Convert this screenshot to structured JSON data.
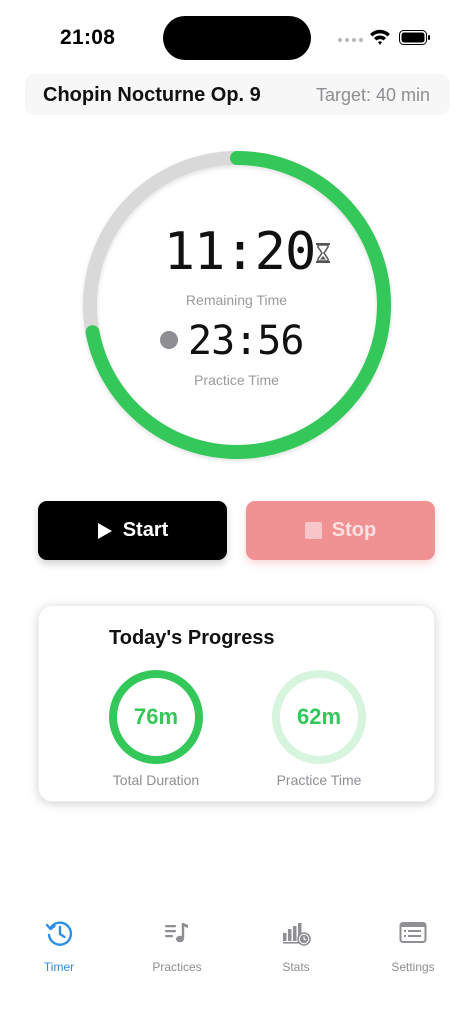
{
  "status_bar": {
    "time": "21:08"
  },
  "header": {
    "piece_title": "Chopin Nocturne Op. 9",
    "target": "Target: 40 min"
  },
  "timer": {
    "remaining_value": "11:20",
    "remaining_label": "Remaining Time",
    "practice_value": "23:56",
    "practice_label": "Practice Time",
    "progress_fraction": 0.72,
    "accent_color": "#34c759",
    "track_color": "#d9d9d9"
  },
  "controls": {
    "start_label": "Start",
    "stop_label": "Stop"
  },
  "progress": {
    "title": "Today's Progress",
    "total_duration": {
      "value": "76m",
      "label": "Total Duration"
    },
    "practice_time": {
      "value": "62m",
      "label": "Practice Time"
    }
  },
  "tabs": [
    {
      "label": "Timer",
      "icon": "clock-history-icon",
      "active": true
    },
    {
      "label": "Practices",
      "icon": "music-list-icon",
      "active": false
    },
    {
      "label": "Stats",
      "icon": "chart-clock-icon",
      "active": false
    },
    {
      "label": "Settings",
      "icon": "settings-panel-icon",
      "active": false
    }
  ],
  "colors": {
    "active_tab": "#2e8ee6",
    "inactive_tab": "#8e8e93",
    "stop_button": "#f09194"
  }
}
